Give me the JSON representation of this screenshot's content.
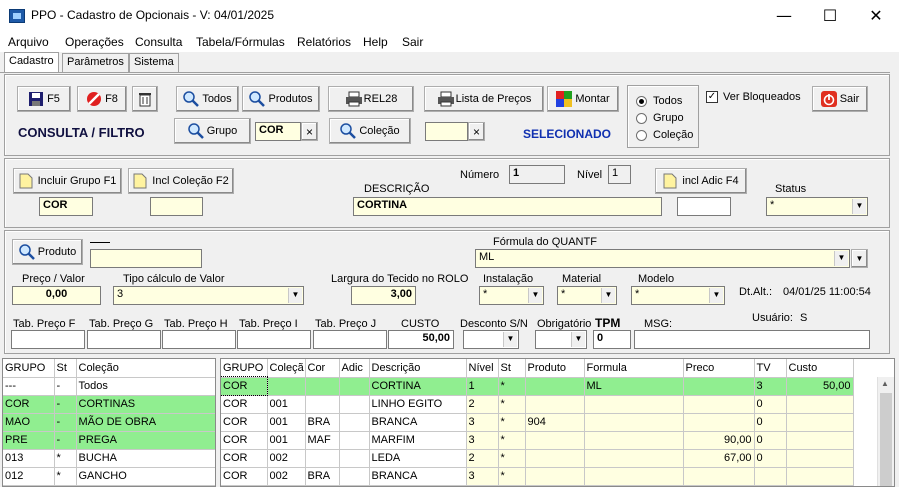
{
  "window": {
    "title": "PPO - Cadastro de Opcionais - V: 04/01/2025"
  },
  "menu": [
    "Arquivo",
    "Operações",
    "Consulta",
    "Tabela/Fórmulas",
    "Relatórios",
    "Help",
    "Sair"
  ],
  "tabs": [
    "Cadastro",
    "Parâmetros",
    "Sistema"
  ],
  "toolbar": {
    "f5": "F5",
    "f8": "F8",
    "todos": "Todos",
    "produtos": "Produtos",
    "rel28": "REL28",
    "lista_precos": "Lista de Preços",
    "montar": "Montar",
    "sair": "Sair",
    "grupo": "Grupo",
    "colecao": "Coleção",
    "grupo_value": "COR",
    "colecao_value": "",
    "consulta_filtro": "CONSULTA / FILTRO",
    "selecionado": "SELECIONADO",
    "radio_todos": "Todos",
    "radio_grupo": "Grupo",
    "radio_colecao": "Coleção",
    "ver_bloqueados": "Ver Bloqueados"
  },
  "form": {
    "incluir_grupo": "Incluir Grupo F1",
    "incl_colecao": "Incl Coleção F2",
    "incl_adic": "incl Adic F4",
    "numero_label": "Número",
    "numero": "1",
    "nivel_label": "Nível",
    "nivel": "1",
    "descricao_label": "DESCRIÇÃO",
    "descricao": "CORTINA",
    "grupo_value": "COR",
    "colecao_value": "",
    "adic_value": "",
    "status_label": "Status",
    "status": "*",
    "produto_btn": "Produto",
    "produto_value": "",
    "formula_label": "Fórmula do QUANTF",
    "formula": "ML",
    "preco_label": "Preço / Valor",
    "preco": "0,00",
    "tipo_calc_label": "Tipo cálculo de Valor",
    "tipo_calc": "3",
    "largura_label": "Largura do Tecido no ROLO",
    "largura": "3,00",
    "instalacao_label": "Instalação",
    "instalacao": "*",
    "material_label": "Material",
    "material": "*",
    "modelo_label": "Modelo",
    "modelo": "*",
    "dtalt_label": "Dt.Alt.:",
    "dtalt": "04/01/25 11:00:54",
    "usuario_label": "Usuário:",
    "usuario": "S",
    "tab_f": "Tab. Preço F",
    "tab_g": "Tab. Preço G",
    "tab_h": "Tab. Preço H",
    "tab_i": "Tab. Preço I",
    "tab_j": "Tab. Preço J",
    "custo_label": "CUSTO",
    "custo": "50,00",
    "desconto_label": "Desconto S/N",
    "obrigatorio_label": "Obrigatório",
    "tpm_label": "TPM",
    "tpm": "0",
    "msg_label": "MSG:"
  },
  "left_grid": {
    "headers": [
      "GRUPO",
      "St",
      "Coleção"
    ],
    "rows": [
      [
        "---",
        "-",
        "Todos"
      ],
      [
        "COR",
        "-",
        "CORTINAS"
      ],
      [
        "MAO",
        "-",
        "MÃO DE OBRA"
      ],
      [
        "PRE",
        "-",
        "PREGA"
      ],
      [
        "013",
        "*",
        "BUCHA"
      ],
      [
        "012",
        "*",
        "GANCHO"
      ]
    ]
  },
  "right_grid": {
    "headers": [
      "GRUPO",
      "Coleçã",
      "Cor",
      "Adic",
      "Descrição",
      "Nível",
      "St",
      "Produto",
      "Formula",
      "Preco",
      "TV",
      "Custo"
    ],
    "rows": [
      [
        "COR",
        "",
        "",
        "",
        "CORTINA",
        "1",
        "*",
        "",
        "ML",
        "",
        "3",
        "50,00"
      ],
      [
        "COR",
        "001",
        "",
        "",
        "LINHO EGITO",
        "2",
        "*",
        "",
        "",
        "",
        "0",
        ""
      ],
      [
        "COR",
        "001",
        "BRA",
        "",
        "BRANCA",
        "3",
        "*",
        "904",
        "",
        "",
        "0",
        ""
      ],
      [
        "COR",
        "001",
        "MAF",
        "",
        "MARFIM",
        "3",
        "*",
        "",
        "",
        "90,00",
        "0",
        ""
      ],
      [
        "COR",
        "002",
        "",
        "",
        "LEDA",
        "2",
        "*",
        "",
        "",
        "67,00",
        "0",
        ""
      ],
      [
        "COR",
        "002",
        "BRA",
        "",
        "BRANCA",
        "3",
        "*",
        "",
        "",
        "",
        "",
        ""
      ]
    ]
  }
}
